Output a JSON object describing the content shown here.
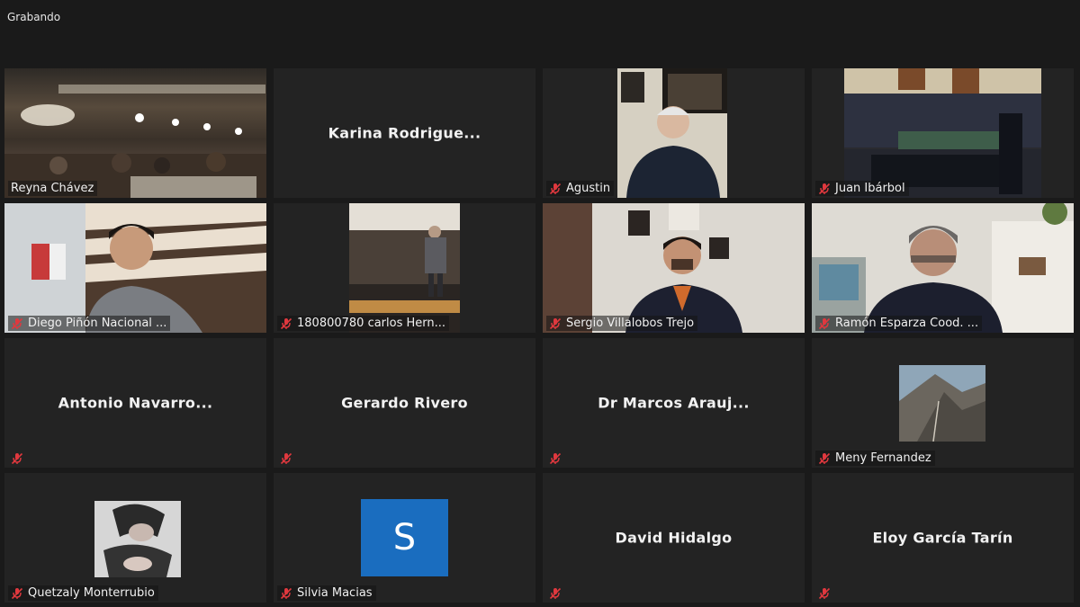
{
  "status": {
    "recording_label": "Grabando"
  },
  "participants": [
    {
      "name": "Reyna Chávez"
    },
    {
      "display": "Karina  Rodrigue..."
    },
    {
      "name": "Agustin"
    },
    {
      "name": "Juan Ibárbol"
    },
    {
      "name": "Diego Piñón Nacional ..."
    },
    {
      "name": "180800780 carlos Hern..."
    },
    {
      "name": "Sergio Villalobos Trejo"
    },
    {
      "name": "Ramón Esparza Cood. ..."
    },
    {
      "display": "Antonio  Navarro..."
    },
    {
      "display": "Gerardo Rivero"
    },
    {
      "display": "Dr  Marcos  Arauj..."
    },
    {
      "name": "Meny Fernandez"
    },
    {
      "name": "Quetzaly Monterrubio"
    },
    {
      "name": "Silvia Macias",
      "avatar_letter": "S"
    },
    {
      "display": "David Hidalgo"
    },
    {
      "display": "Eloy García Tarín"
    }
  ],
  "icons": {
    "muted": "mic-muted-icon"
  },
  "colors": {
    "active_border": "#c8e06a",
    "muted_icon": "#e0383e",
    "avatar_bg": "#1a6dbf",
    "tile_bg": "#232323"
  }
}
